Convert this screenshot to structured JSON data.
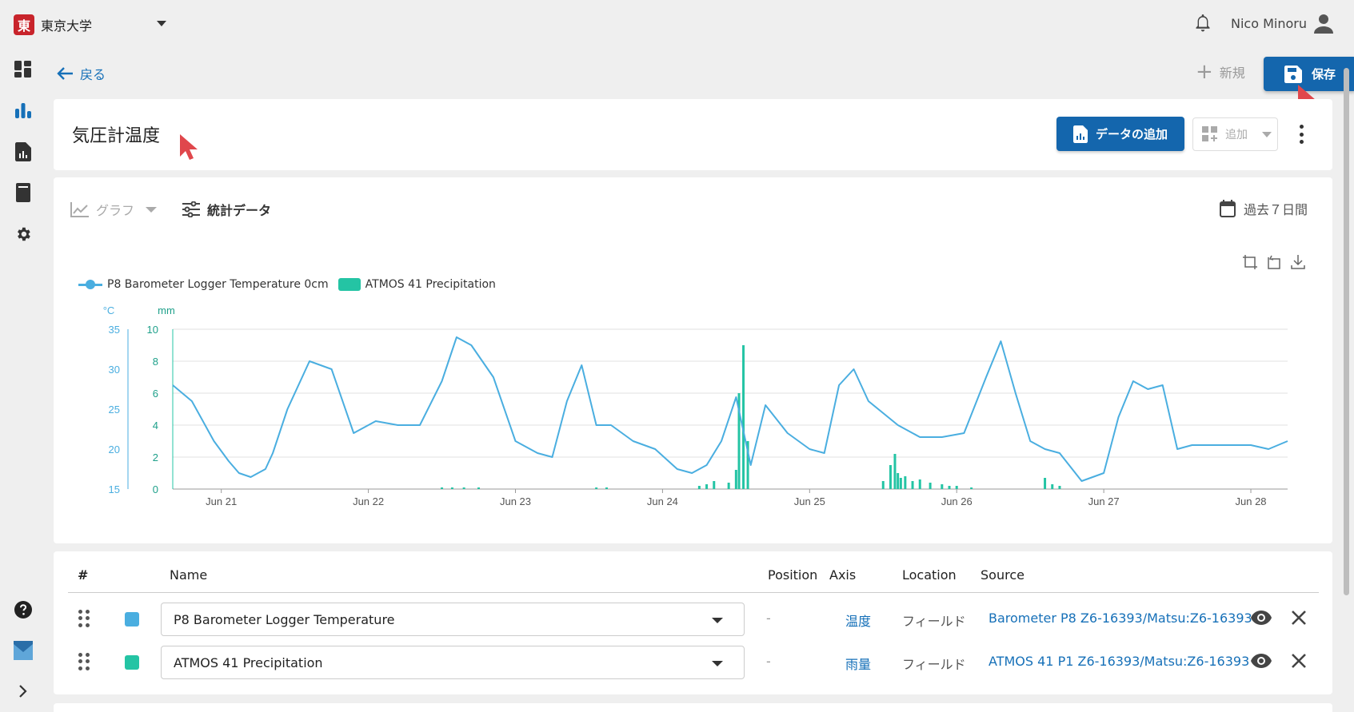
{
  "org": {
    "logo_char": "東",
    "name": "東京大学"
  },
  "user": {
    "name": "Nico Minoru"
  },
  "nav": {
    "back_label": "戻る",
    "new_label": "新規",
    "save_label": "保存"
  },
  "panel": {
    "title": "気圧計温度",
    "add_data_label": "データの追加",
    "add_widget_label": "追加"
  },
  "toolbar": {
    "chart_type_label": "グラフ",
    "stats_label": "統計データ",
    "range_label": "過去７日間"
  },
  "legend": {
    "series1": "P8 Barometer Logger Temperature 0cm",
    "series2": "ATMOS 41 Precipitation"
  },
  "table": {
    "headers": {
      "index": "#",
      "name": "Name",
      "position": "Position",
      "axis": "Axis",
      "location": "Location",
      "source": "Source"
    },
    "rows": [
      {
        "color": "#4aaee0",
        "name": "P8 Barometer Logger Temperature",
        "position": "-",
        "axis": "温度",
        "location": "フィールド",
        "source": "Barometer P8 Z6-16393/Matsu:Z6-16393"
      },
      {
        "color": "#24c4a4",
        "name": "ATMOS 41 Precipitation",
        "position": "-",
        "axis": "雨量",
        "location": "フィールド",
        "source": "ATMOS 41 P1 Z6-16393/Matsu:Z6-16393"
      }
    ]
  },
  "colors": {
    "primary": "#1466ad",
    "link": "#1670b8",
    "temperature": "#4aaee0",
    "precipitation": "#24c4a4"
  },
  "chart_data": {
    "type": "line",
    "x_ticks": [
      "Jun 21",
      "Jun 22",
      "Jun 23",
      "Jun 24",
      "Jun 25",
      "Jun 26",
      "Jun 27",
      "Jun 28"
    ],
    "y_left": {
      "unit": "°C",
      "ticks": [
        15,
        20,
        25,
        30,
        35
      ],
      "range": [
        15,
        35
      ]
    },
    "y_right": {
      "unit": "mm",
      "ticks": [
        0,
        2,
        4,
        6,
        8,
        10
      ],
      "range": [
        0,
        10
      ]
    },
    "grid": true,
    "legend_position": "top-left",
    "series": [
      {
        "name": "P8 Barometer Logger Temperature 0cm",
        "kind": "line",
        "axis": "left",
        "color": "#4aaee0",
        "x": [
          20.67,
          20.8,
          20.95,
          21.05,
          21.12,
          21.2,
          21.3,
          21.35,
          21.45,
          21.6,
          21.75,
          21.9,
          22.05,
          22.2,
          22.35,
          22.5,
          22.6,
          22.7,
          22.85,
          23.0,
          23.15,
          23.25,
          23.35,
          23.45,
          23.55,
          23.65,
          23.8,
          23.95,
          24.1,
          24.2,
          24.3,
          24.4,
          24.5,
          24.6,
          24.7,
          24.85,
          25.0,
          25.1,
          25.2,
          25.3,
          25.4,
          25.5,
          25.6,
          25.75,
          25.9,
          26.05,
          26.2,
          26.3,
          26.4,
          26.5,
          26.6,
          26.7,
          26.85,
          27.0,
          27.1,
          27.2,
          27.3,
          27.4,
          27.5,
          27.6,
          27.7,
          27.85,
          28.0,
          28.12,
          28.25
        ],
        "y": [
          28,
          26,
          21,
          18.5,
          17,
          16.5,
          17.5,
          19.5,
          25,
          31,
          30,
          22,
          23.5,
          23,
          23,
          28.5,
          34,
          33,
          29,
          21,
          19.5,
          19,
          26,
          30.5,
          23,
          23,
          21,
          20,
          17.5,
          17,
          18,
          21,
          26.5,
          18,
          25.5,
          22,
          20,
          19.5,
          28,
          30,
          26,
          24.5,
          23,
          21.5,
          21.5,
          22,
          29,
          33.5,
          27,
          21,
          20,
          19.5,
          16,
          17,
          24,
          28.5,
          27.5,
          28,
          20,
          20.5,
          20.5,
          20.5,
          20.5,
          20,
          21
        ]
      },
      {
        "name": "ATMOS 41 Precipitation",
        "kind": "bar",
        "axis": "right",
        "color": "#24c4a4",
        "x": [
          22.5,
          22.57,
          22.65,
          22.75,
          23.55,
          23.62,
          24.25,
          24.3,
          24.35,
          24.45,
          24.5,
          24.52,
          24.55,
          24.58,
          25.5,
          25.55,
          25.58,
          25.6,
          25.62,
          25.65,
          25.7,
          25.75,
          25.82,
          25.9,
          25.95,
          26.0,
          26.1,
          26.6,
          26.65,
          26.7
        ],
        "y": [
          0.1,
          0.1,
          0.1,
          0.1,
          0.1,
          0.1,
          0.2,
          0.3,
          0.5,
          0.4,
          1.2,
          6,
          9,
          3,
          0.5,
          1.5,
          2.2,
          1,
          0.7,
          0.8,
          0.5,
          0.6,
          0.4,
          0.3,
          0.2,
          0.2,
          0.1,
          0.7,
          0.3,
          0.2
        ]
      }
    ]
  }
}
